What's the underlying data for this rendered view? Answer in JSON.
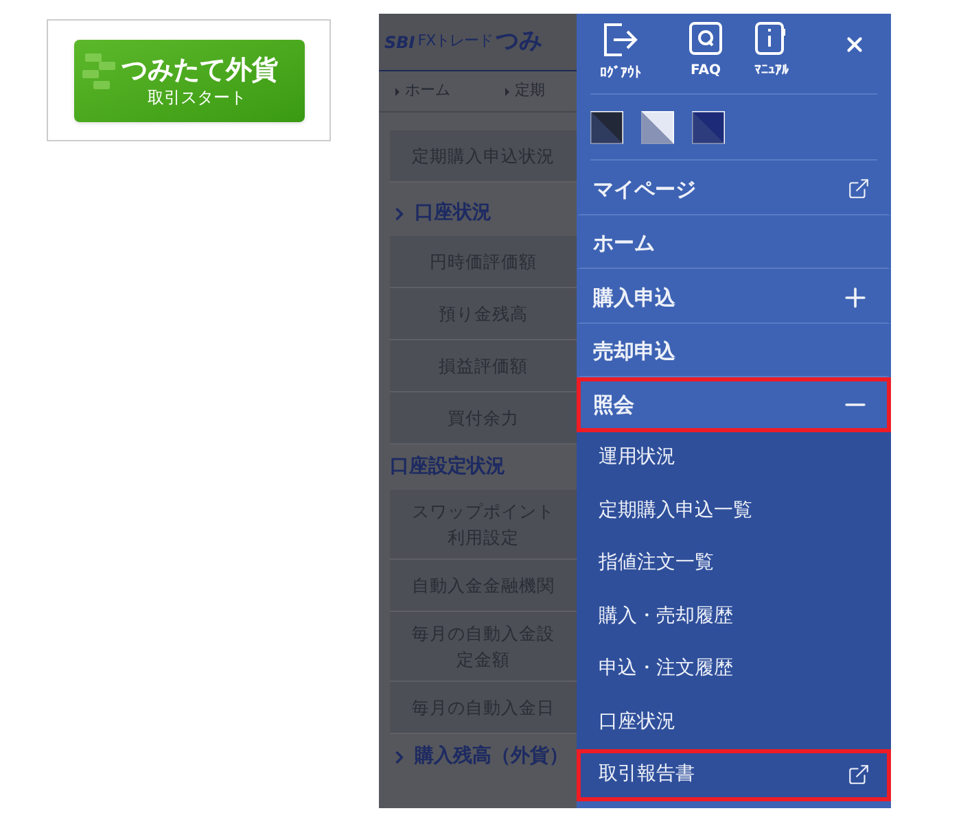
{
  "promo": {
    "title": "つみたて外貨",
    "subtitle": "取引スタート"
  },
  "app": {
    "logo_brand": "SBI",
    "logo_text": "FXトレード",
    "logo_title": "つみ",
    "breadcrumbs": [
      "ホーム",
      "定期"
    ],
    "blocks": [
      {
        "kind": "item",
        "label": "定期購入申込状況"
      },
      {
        "kind": "heading",
        "label": "口座状況",
        "chevron": true
      },
      {
        "kind": "item",
        "label": "円時価評価額"
      },
      {
        "kind": "item",
        "label": "預り金残高"
      },
      {
        "kind": "item",
        "label": "損益評価額"
      },
      {
        "kind": "item",
        "label": "買付余力"
      },
      {
        "kind": "heading",
        "label": "口座設定状況",
        "chevron": false
      },
      {
        "kind": "item",
        "label": "スワップポイント利用設定"
      },
      {
        "kind": "item",
        "label": "自動入金金融機関"
      },
      {
        "kind": "item",
        "label": "毎月の自動入金設定金額"
      },
      {
        "kind": "item",
        "label": "毎月の自動入金日"
      },
      {
        "kind": "heading",
        "label": "購入残高（外貨）",
        "chevron": true
      }
    ]
  },
  "menu": {
    "tools": [
      {
        "kind": "logout",
        "label": "ﾛｸﾞｱｳﾄ"
      },
      {
        "kind": "faq",
        "label": "FAQ"
      },
      {
        "kind": "manual",
        "label": "ﾏﾆｭｱﾙ"
      }
    ],
    "themes": [
      {
        "color": "#232838"
      },
      {
        "color": "#e4e8f4"
      },
      {
        "color": "#1c2a78"
      }
    ],
    "items": [
      {
        "label": "マイページ",
        "external": true,
        "highlighted": false
      },
      {
        "label": "ホーム",
        "highlighted": false
      },
      {
        "label": "購入申込",
        "expanded": false,
        "highlighted": false
      },
      {
        "label": "売却申込",
        "highlighted": false
      },
      {
        "label": "照会",
        "expanded": true,
        "highlighted": true,
        "children": [
          {
            "label": "運用状況",
            "highlighted": false
          },
          {
            "label": "定期購入申込一覧",
            "highlighted": false
          },
          {
            "label": "指値注文一覧",
            "highlighted": false
          },
          {
            "label": "購入・売却履歴",
            "highlighted": false
          },
          {
            "label": "申込・注文履歴",
            "highlighted": false
          },
          {
            "label": "口座状況",
            "highlighted": false
          },
          {
            "label": "取引報告書",
            "external": true,
            "highlighted": true
          }
        ]
      }
    ]
  }
}
